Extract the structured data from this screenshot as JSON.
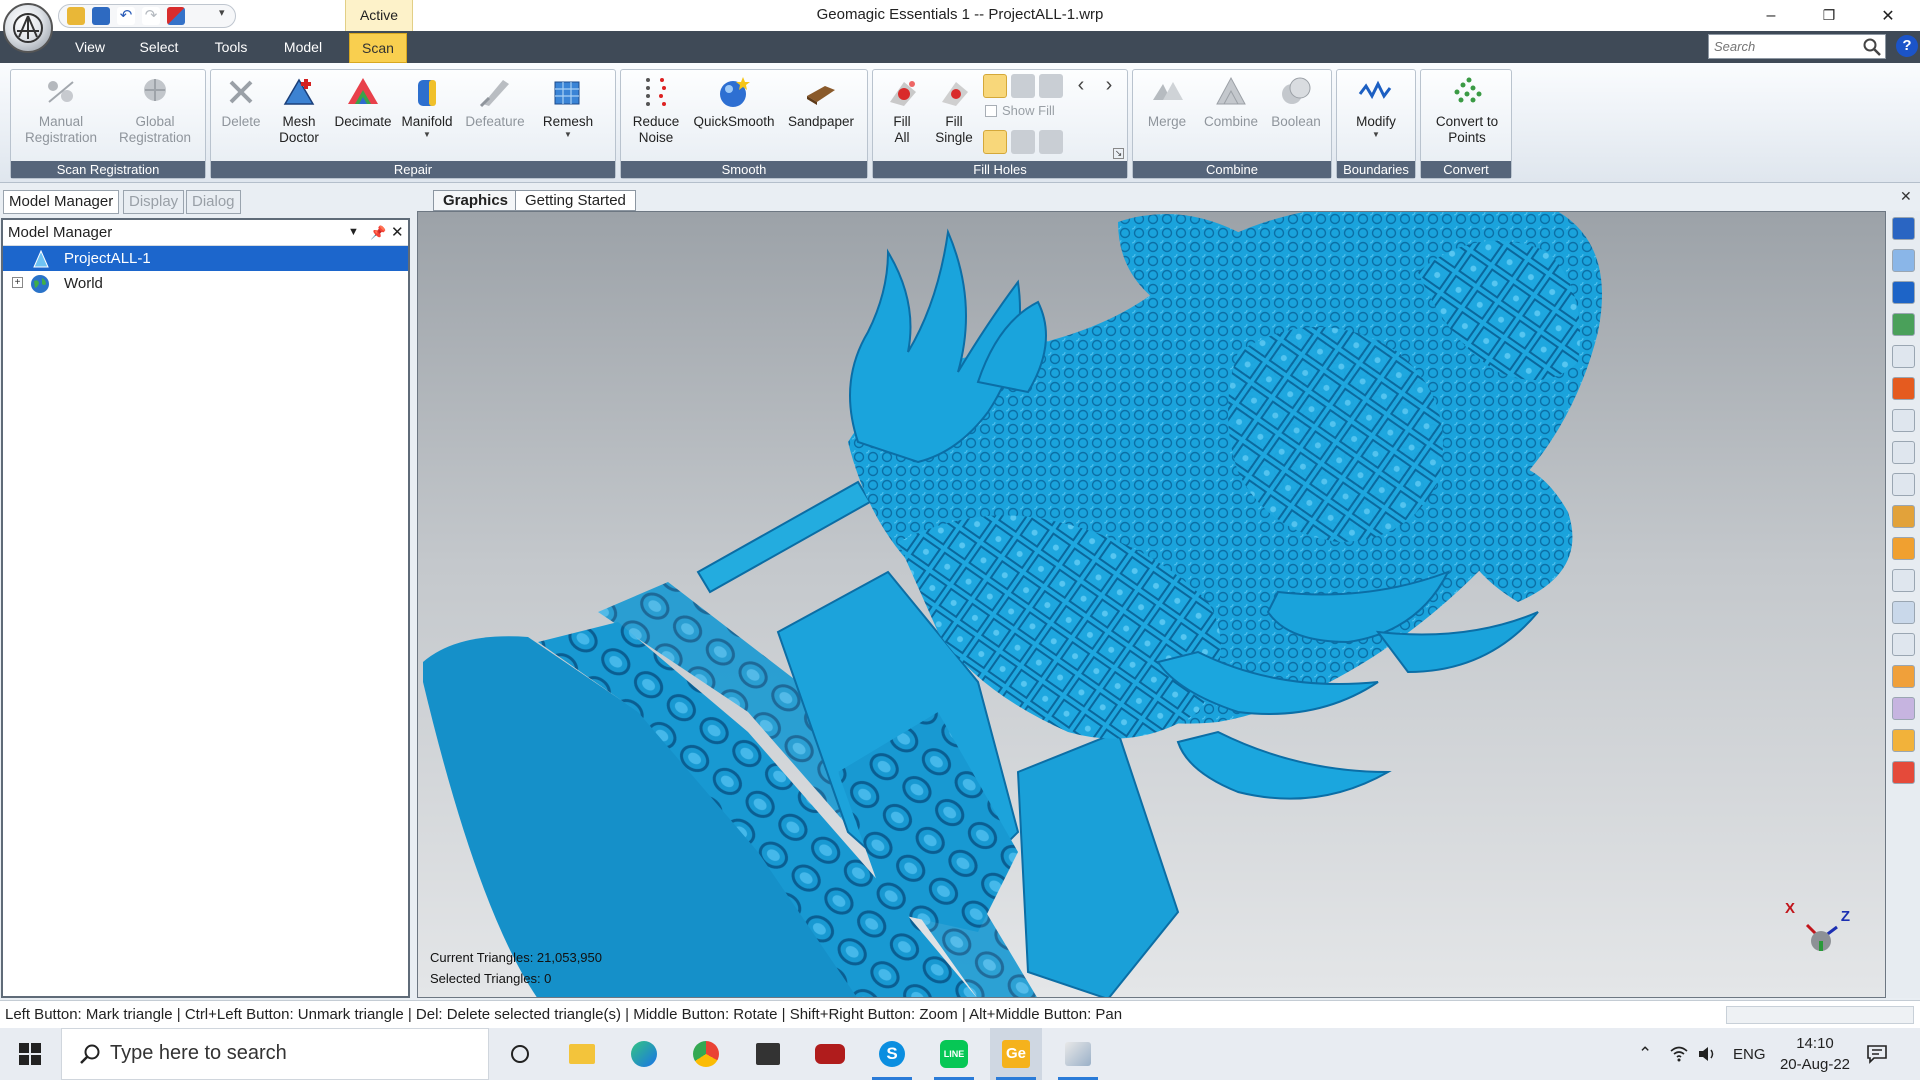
{
  "titlebar": {
    "title": "Geomagic Essentials 1 -- ProjectALL-1.wrp",
    "context_tab": "Active",
    "controls": {
      "minimize": "–",
      "restore": "❐",
      "close": "✕"
    },
    "qat_more": "▾"
  },
  "menu": {
    "items": [
      "View",
      "Select",
      "Tools",
      "Model",
      "Scan"
    ],
    "active": "Scan",
    "search_placeholder": "Search",
    "help": "?"
  },
  "ribbon": {
    "groups": {
      "scan_registration": {
        "label": "Scan Registration",
        "buttons": [
          "Manual\nRegistration",
          "Global\nRegistration"
        ]
      },
      "repair": {
        "label": "Repair",
        "buttons": [
          "Delete",
          "Mesh\nDoctor",
          "Decimate",
          "Manifold",
          "Defeature",
          "Remesh"
        ]
      },
      "smooth": {
        "label": "Smooth",
        "buttons": [
          "Reduce\nNoise",
          "QuickSmooth",
          "Sandpaper"
        ]
      },
      "fill_holes": {
        "label": "Fill Holes",
        "buttons": [
          "Fill\nAll",
          "Fill\nSingle"
        ],
        "show_fill": "Show Fill"
      },
      "combine": {
        "label": "Combine",
        "buttons": [
          "Merge",
          "Combine",
          "Boolean"
        ]
      },
      "boundaries": {
        "label": "Boundaries",
        "buttons": [
          "Modify"
        ]
      },
      "convert": {
        "label": "Convert",
        "buttons": [
          "Convert to\nPoints"
        ]
      }
    }
  },
  "panel": {
    "tabs": [
      "Model Manager",
      "Display",
      "Dialog"
    ],
    "active_tab": "Model Manager",
    "title": "Model Manager",
    "tree": [
      "ProjectALL-1",
      "World"
    ],
    "selected": "ProjectALL-1"
  },
  "graphics": {
    "tabs": [
      "Graphics",
      "Getting Started"
    ],
    "active_tab": "Graphics",
    "current_triangles": "Current Triangles: 21,053,950",
    "selected_triangles": "Selected Triangles: 0",
    "axis_x": "X",
    "axis_z": "Z"
  },
  "status": {
    "text": "Left Button: Mark triangle | Ctrl+Left Button: Unmark triangle | Del: Delete selected triangle(s) | Middle Button: Rotate | Shift+Right Button: Zoom | Alt+Middle Button: Pan"
  },
  "taskbar": {
    "search_placeholder": "Type here to search",
    "language": "ENG",
    "time": "14:10",
    "date": "20-Aug-22"
  },
  "colors": {
    "menu_bg": "#3f4a57",
    "active_menu": "#f9cf4f",
    "selection": "#1c66cc",
    "model_blue": "#1aa3dc",
    "group_label_bg": "#56657a"
  }
}
